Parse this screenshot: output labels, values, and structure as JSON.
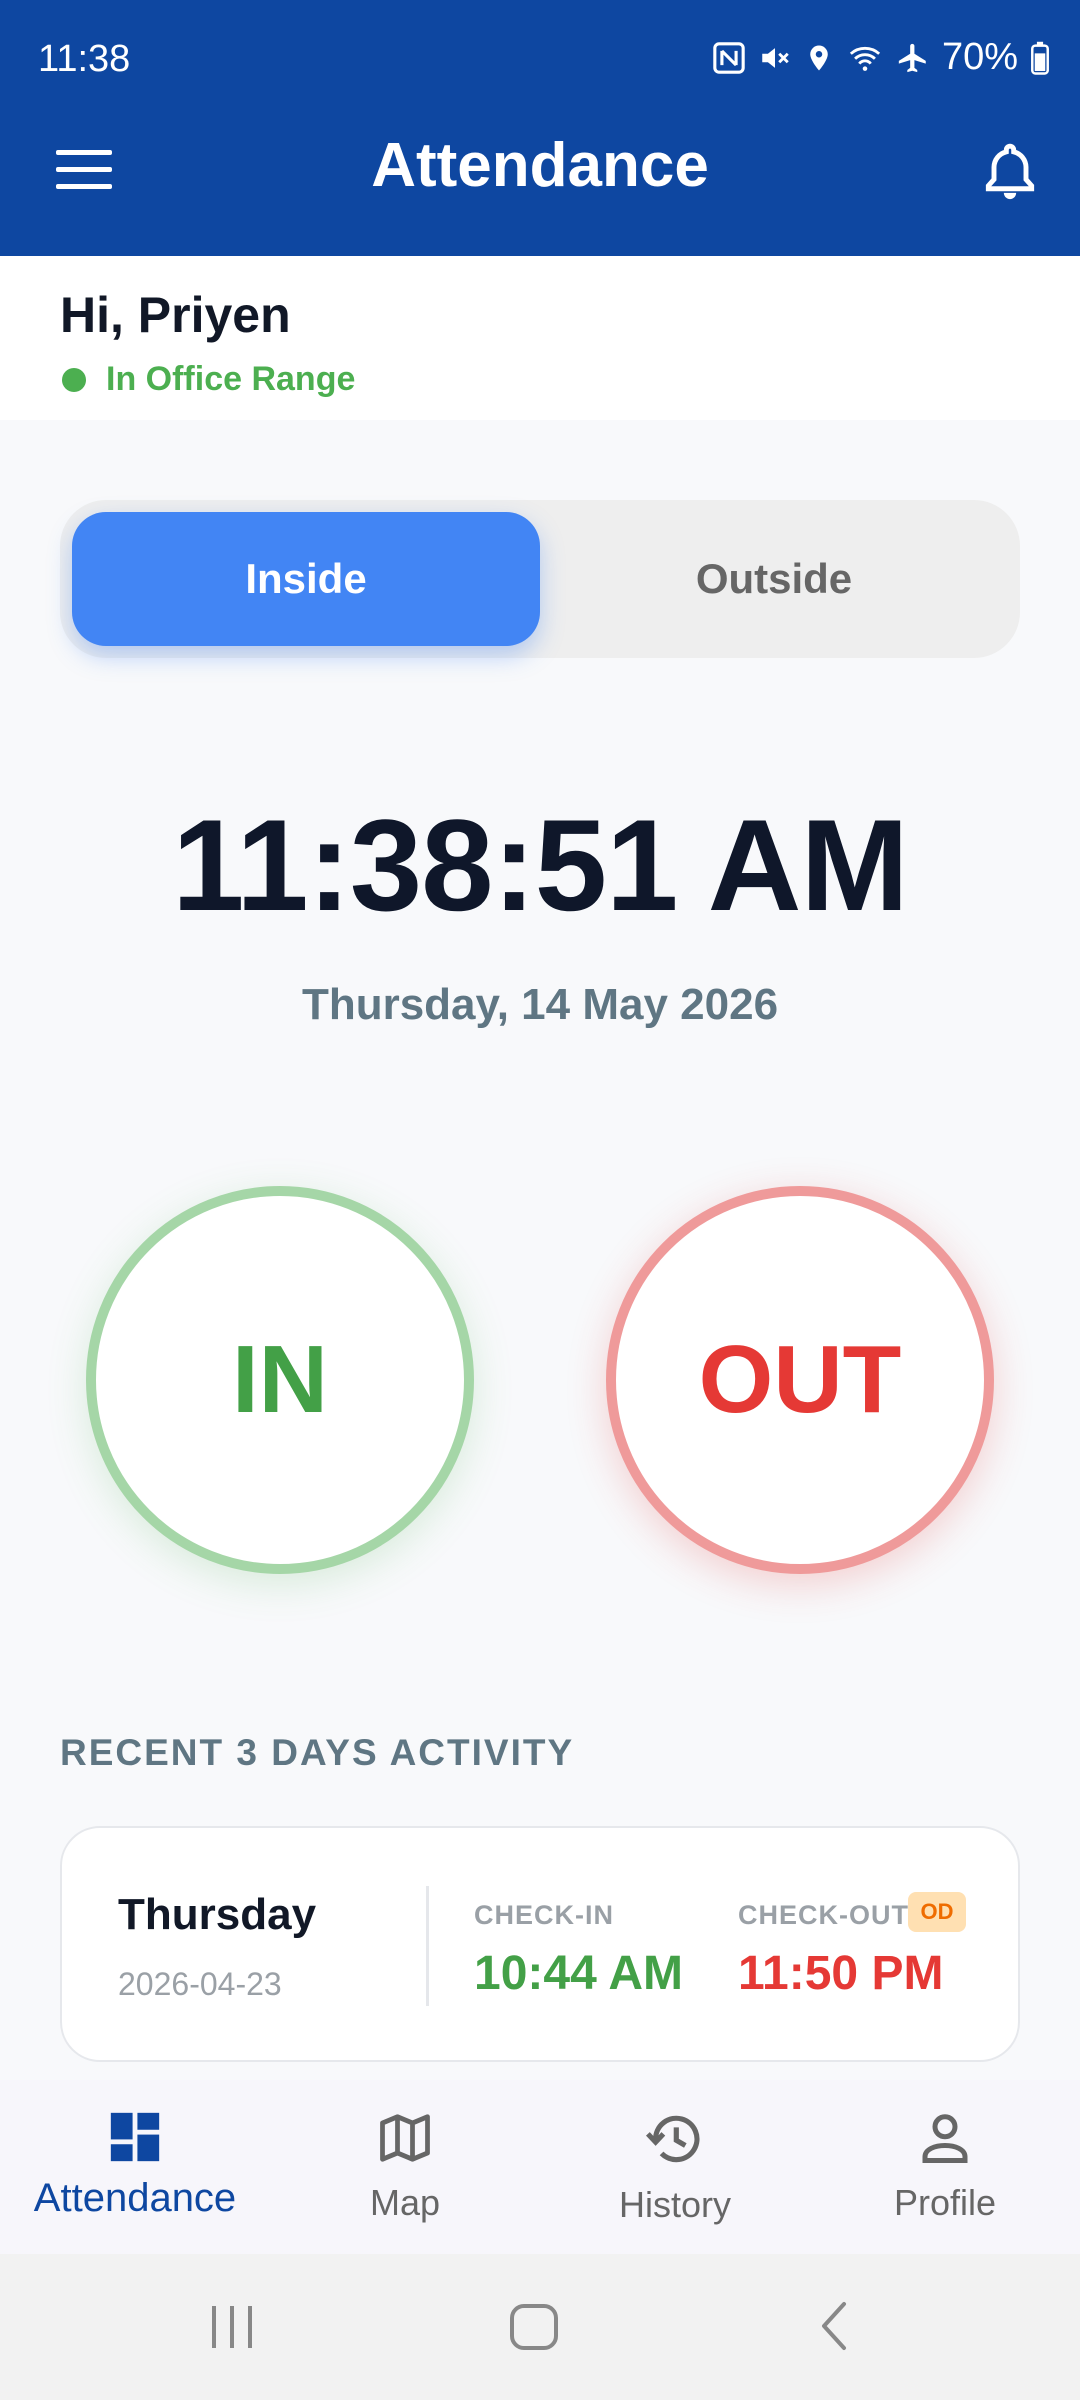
{
  "status_bar": {
    "time": "11:38",
    "battery": "70%",
    "icons": [
      "nfc-icon",
      "mute-icon",
      "location-icon",
      "wifi-icon",
      "airplane-icon",
      "battery-icon"
    ]
  },
  "app_bar": {
    "title": "Attendance",
    "left_icon": "menu-icon",
    "right_icon": "bell-icon",
    "color": "#0e47a1"
  },
  "greeting": {
    "name": "Hi, Priyen",
    "status": "In Office Range",
    "status_color": "#4caf50"
  },
  "segment": {
    "options": [
      "Inside",
      "Outside"
    ],
    "selected": "Inside",
    "accent": "#4285f4"
  },
  "clock": {
    "time": "11:38:51 AM",
    "date": "Thursday, 14 May 2026"
  },
  "actions": {
    "in_label": "IN",
    "out_label": "OUT",
    "in_color": "#43a047",
    "out_color": "#e53935"
  },
  "recent": {
    "title": "RECENT 3 DAYS ACTIVITY",
    "items": [
      {
        "day": "Thursday",
        "date": "2026-04-23",
        "checkin_label": "CHECK-IN",
        "checkin_time": "10:44 AM",
        "checkout_label": "CHECK-OUT",
        "checkout_badge": "OD",
        "checkout_time": "11:50 PM"
      }
    ]
  },
  "bottom_nav": {
    "items": [
      {
        "label": "Attendance",
        "icon": "dashboard-icon",
        "active": true
      },
      {
        "label": "Map",
        "icon": "map-icon",
        "active": false
      },
      {
        "label": "History",
        "icon": "history-icon",
        "active": false
      },
      {
        "label": "Profile",
        "icon": "person-icon",
        "active": false
      }
    ]
  },
  "system_nav": {
    "buttons": [
      "recents-icon",
      "home-icon",
      "back-icon"
    ]
  }
}
